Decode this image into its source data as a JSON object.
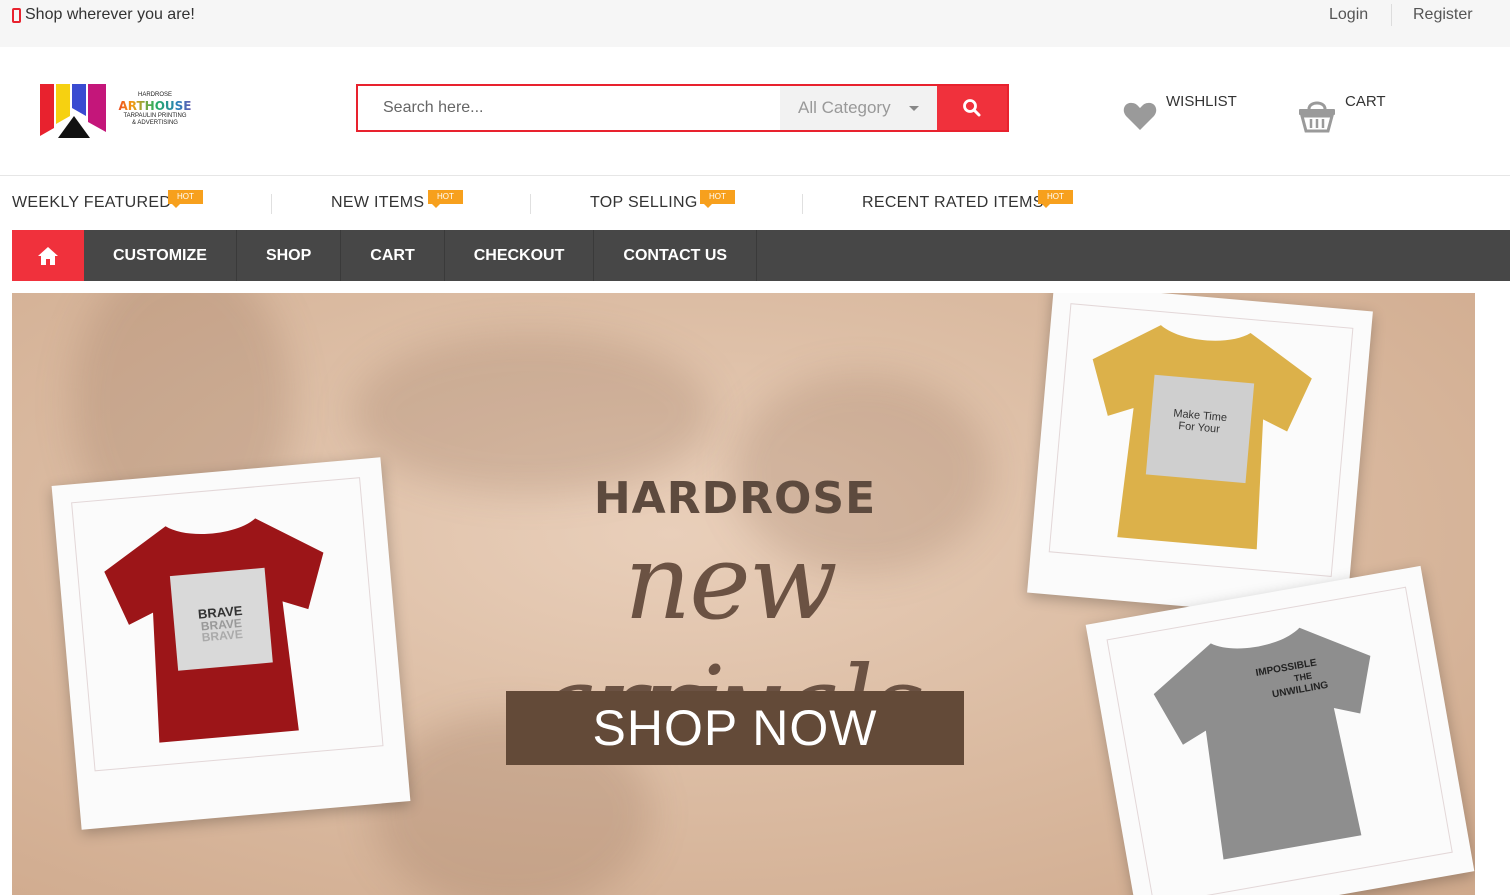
{
  "topbar": {
    "tagline": "Shop wherever you are!",
    "login": "Login",
    "register": "Register"
  },
  "logo": {
    "line1": "HARDROSE",
    "line2": "ARTHOUSE",
    "line3": "TARPAULIN PRINTING",
    "line4": "& ADVERTISING"
  },
  "search": {
    "placeholder": "Search here...",
    "category": "All Category"
  },
  "header": {
    "wishlist": "WISHLIST",
    "cart": "CART"
  },
  "featured": [
    {
      "label": "WEEKLY FEATURED",
      "badge": "HOT"
    },
    {
      "label": "NEW ITEMS",
      "badge": "HOT"
    },
    {
      "label": "TOP SELLING",
      "badge": "HOT"
    },
    {
      "label": "RECENT RATED ITEMS",
      "badge": "HOT"
    }
  ],
  "nav": {
    "items": [
      "CUSTOMIZE",
      "SHOP",
      "CART",
      "CHECKOUT",
      "CONTACT US"
    ]
  },
  "banner": {
    "brand": "HARDROSE",
    "headline": "new arrivals",
    "cta": "SHOP NOW",
    "shirt_text_red": "BRAVE",
    "shirt_text_yellow_1": "Make Time",
    "shirt_text_yellow_2": "For Your",
    "shirt_text_gray_1": "IMPOSSIBLE",
    "shirt_text_gray_2": "THE",
    "shirt_text_gray_3": "UNWILLING"
  },
  "colors": {
    "accent": "#f0313c",
    "badge": "#f7a01d",
    "nav": "#474747",
    "cta": "#634a38"
  }
}
